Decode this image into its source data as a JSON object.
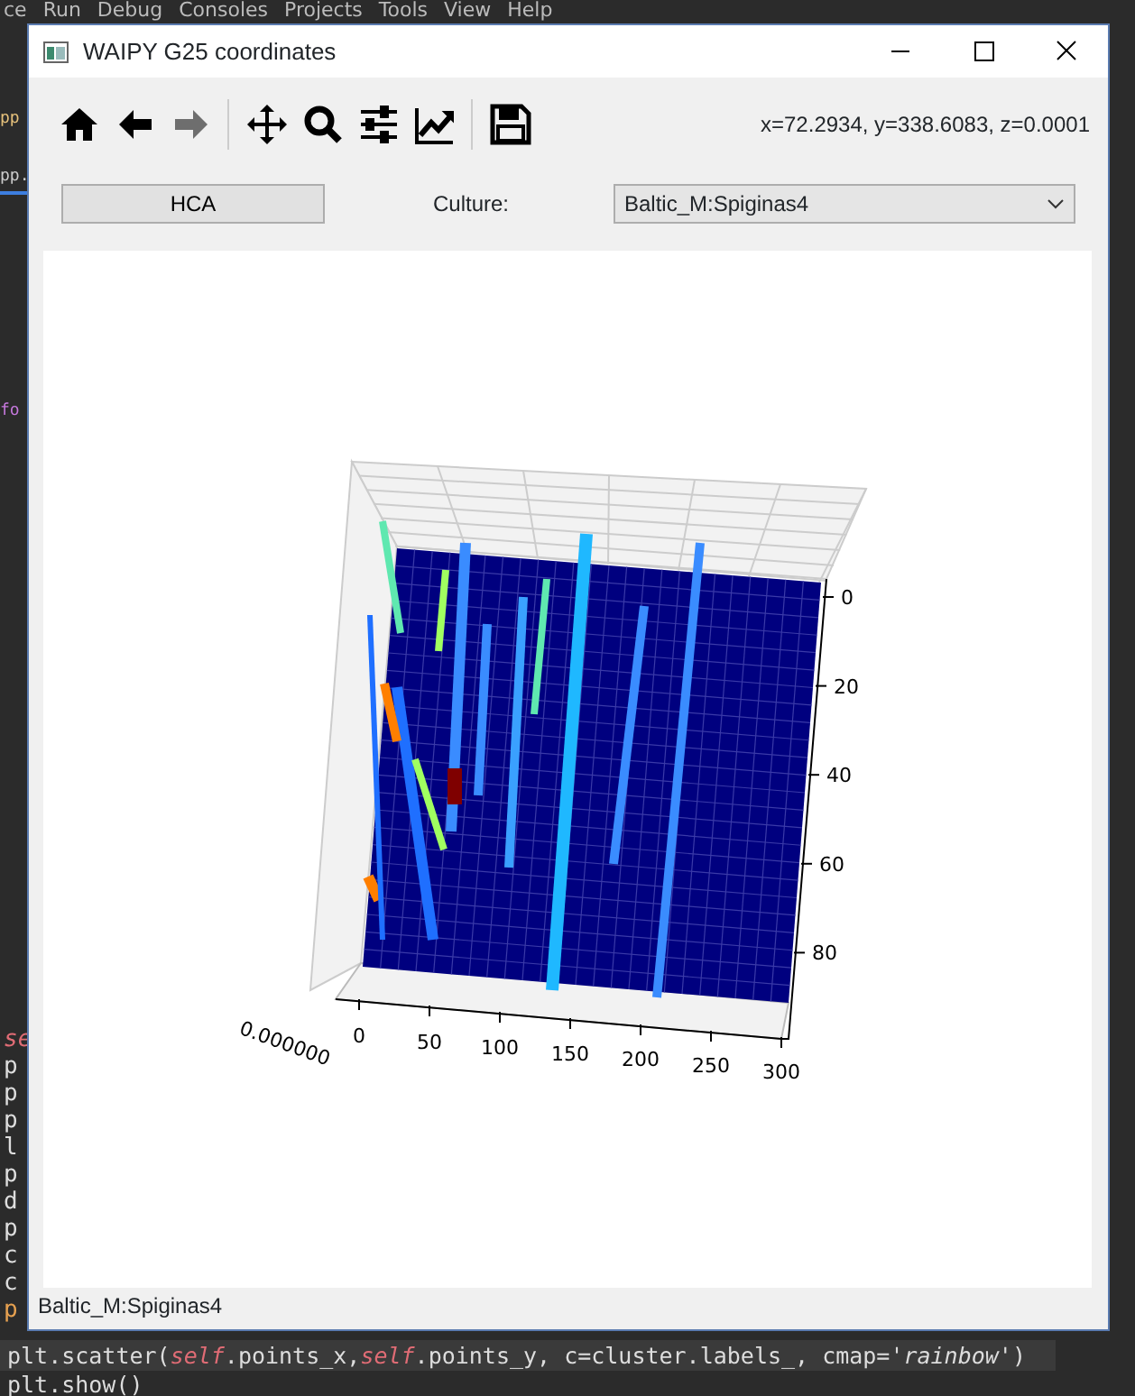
{
  "ide": {
    "menu": [
      "ce",
      "Run",
      "Debug",
      "Consoles",
      "Projects",
      "Tools",
      "View",
      "Help"
    ],
    "side_fragments": [
      {
        "text": "pp",
        "kind": "tab"
      },
      {
        "text": "pp.",
        "kind": "tab-active"
      },
      {
        "text": "fo",
        "kind": "keyword"
      }
    ],
    "code_fragments": [
      {
        "text": "se",
        "kind": "self"
      },
      {
        "text": "p",
        "kind": "plain"
      },
      {
        "text": "p",
        "kind": "plain"
      },
      {
        "text": "p",
        "kind": "plain"
      },
      {
        "text": "l",
        "kind": "plain"
      },
      {
        "text": "p",
        "kind": "plain"
      },
      {
        "text": "d",
        "kind": "plain"
      },
      {
        "text": "p",
        "kind": "plain"
      },
      {
        "text": "c",
        "kind": "plain"
      },
      {
        "text": "c",
        "kind": "plain"
      },
      {
        "text": "p",
        "kind": "keyword"
      }
    ],
    "code_lines": [
      {
        "text": "plt.scatter(**self**.points_x,**self**.points_y, c=cluster.labels_, cmap=*'rainbow'*)",
        "selected": true
      },
      {
        "text": "plt.show()",
        "selected": false
      }
    ]
  },
  "window": {
    "title": "WAIPY G25 coordinates",
    "toolbar": [
      [
        {
          "kind": "home",
          "disabled": false
        },
        {
          "kind": "back",
          "disabled": false
        },
        {
          "kind": "forward",
          "disabled": true
        }
      ],
      [
        {
          "kind": "pan",
          "disabled": false
        },
        {
          "kind": "zoom",
          "disabled": false
        },
        {
          "kind": "subplots",
          "disabled": false
        },
        {
          "kind": "customize",
          "disabled": false
        }
      ],
      [
        {
          "kind": "save",
          "disabled": false
        }
      ]
    ],
    "coordinates": "x=72.2934, y=338.6083, z=0.0001",
    "hca_button": "HCA",
    "culture_label": "Culture:",
    "culture_value": "Baltic_M:Spiginas4",
    "plot": {
      "x_ticks": [
        "0",
        "50",
        "100",
        "150",
        "200",
        "250",
        "300"
      ],
      "y_ticks": [
        "0",
        "20",
        "40",
        "60",
        "80"
      ],
      "z_tick_label": "0.000000"
    },
    "status": "Baltic_M:Spiginas4"
  }
}
